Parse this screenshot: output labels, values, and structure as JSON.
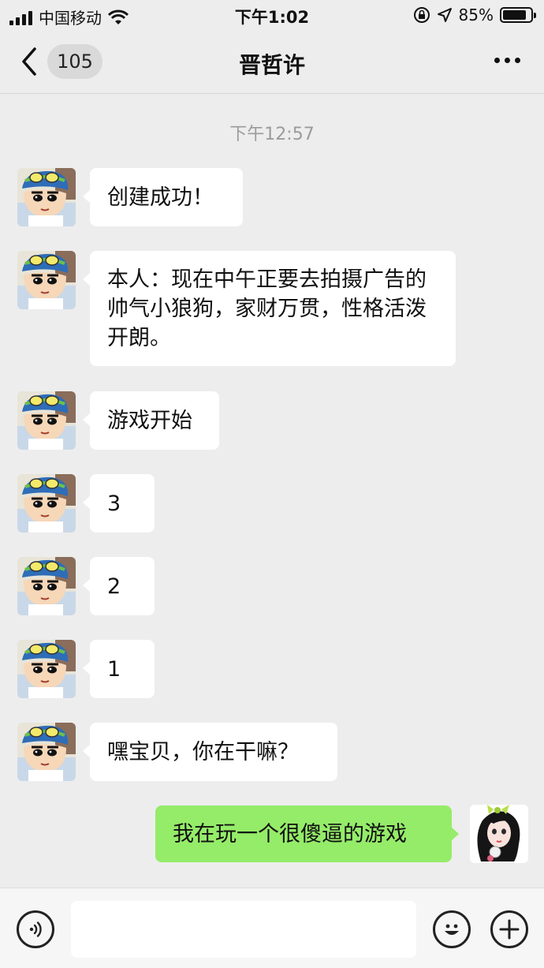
{
  "status_bar": {
    "carrier": "中国移动",
    "time": "下午1:02",
    "battery_percent": "85%",
    "battery_level": 0.85,
    "icons": [
      "signal-icon",
      "wifi-icon",
      "orientation-lock-icon",
      "location-icon",
      "battery-icon"
    ]
  },
  "nav": {
    "unread_count": "105",
    "title": "晋哲许"
  },
  "chat": {
    "timestamp": "下午12:57",
    "messages": [
      {
        "from": "other",
        "text": "创建成功！"
      },
      {
        "from": "other",
        "text": "本人：现在中午正要去拍摄广告的帅气小狼狗，家财万贯，性格活泼开朗。"
      },
      {
        "from": "other",
        "text": "游戏开始"
      },
      {
        "from": "other",
        "text": "3"
      },
      {
        "from": "other",
        "text": "2"
      },
      {
        "from": "other",
        "text": "1"
      },
      {
        "from": "other",
        "text": "嘿宝贝，你在干嘛？"
      },
      {
        "from": "me",
        "text": "我在玩一个很傻逼的游戏"
      }
    ]
  },
  "input_bar": {
    "value": "",
    "placeholder": ""
  },
  "colors": {
    "background": "#ededed",
    "incoming_bubble": "#ffffff",
    "outgoing_bubble": "#95ec69",
    "timestamp_text": "#9b9b9b"
  }
}
